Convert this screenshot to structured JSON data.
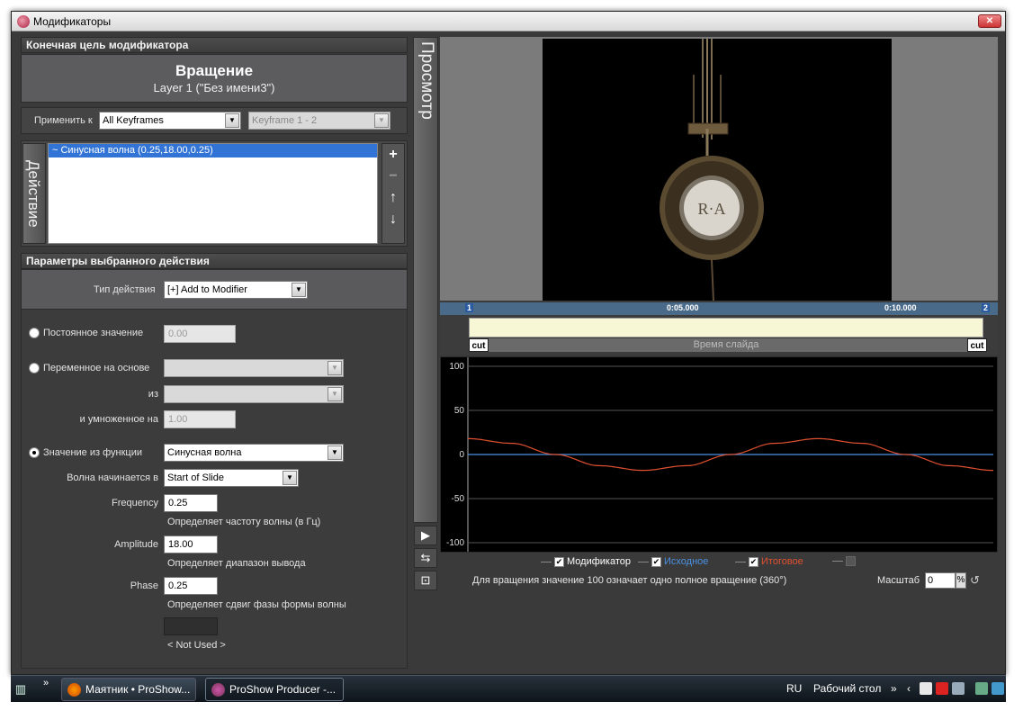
{
  "window": {
    "title": "Модификаторы",
    "close_label": "✕"
  },
  "target": {
    "header": "Конечная цель модификатора",
    "name": "Вращение",
    "layer": "Layer 1 (\"Без имени3\")"
  },
  "apply": {
    "label": "Применить к",
    "keyframes_value": "All Keyframes",
    "keyframe_range_value": "Keyframe 1 - 2"
  },
  "actions": {
    "tab_label": "Действие",
    "items": [
      "~ Синусная волна (0.25,18.00,0.25)"
    ],
    "buttons": {
      "add": "+",
      "remove": "−",
      "up": "↑",
      "down": "↓"
    }
  },
  "params": {
    "header": "Параметры выбранного действия",
    "type_label": "Тип действия",
    "type_value": "[+] Add to Modifier",
    "constant": {
      "label": "Постоянное значение",
      "value": "0.00",
      "selected": false
    },
    "variable": {
      "label": "Переменное на основе",
      "from_label": "из",
      "multiply_label": "и умноженное на",
      "multiply_value": "1.00",
      "selected": false
    },
    "function": {
      "label": "Значение из функции",
      "value": "Синусная волна",
      "selected": true,
      "wave_start_label": "Волна начинается в",
      "wave_start_value": "Start of Slide",
      "frequency_label": "Frequency",
      "frequency_value": "0.25",
      "frequency_hint": "Определяет частоту волны (в Гц)",
      "amplitude_label": "Amplitude",
      "amplitude_value": "18.00",
      "amplitude_hint": "Определяет диапазон вывода",
      "phase_label": "Phase",
      "phase_value": "0.25",
      "phase_hint": "Определяет сдвиг фазы формы волны",
      "not_used": "< Not Used >"
    }
  },
  "preview": {
    "tab_label": "Просмотр",
    "timeline": {
      "start_marker": "1",
      "end_marker": "2",
      "tick_1": "0:05.000",
      "tick_2": "0:10.000",
      "bar_label": "Время слайда",
      "cut_left": "cut",
      "cut_right": "cut"
    }
  },
  "chart_data": {
    "type": "line",
    "title": "",
    "xlabel": "",
    "ylabel": "",
    "ylim": [
      -100,
      100
    ],
    "yticks": [
      "100",
      "50",
      "0",
      "-50",
      "-100"
    ],
    "grid": true,
    "series": [
      {
        "name": "Модификатор",
        "color": "#ffffff",
        "visible": true,
        "values": []
      },
      {
        "name": "Исходное",
        "color": "#4a90e2",
        "visible": true,
        "values": [
          0,
          0,
          0,
          0,
          0,
          0,
          0,
          0,
          0,
          0,
          0,
          0,
          0
        ]
      },
      {
        "name": "Итоговое",
        "color": "#e05030",
        "visible": true,
        "values": [
          18,
          12.7,
          0,
          -12.7,
          -18,
          -12.7,
          0,
          12.7,
          18,
          12.7,
          0,
          -12.7,
          -18
        ]
      }
    ],
    "x": [
      0,
      1,
      2,
      3,
      4,
      5,
      6,
      7,
      8,
      9,
      10,
      11,
      12
    ]
  },
  "legend": {
    "modifier": "Модификатор",
    "original": "Исходное",
    "result": "Итоговое",
    "fourth": ""
  },
  "footer": {
    "note": "Для вращения значение 100 означает одно полное вращение (360°)",
    "scale_label": "Масштаб",
    "scale_value": "0",
    "scale_unit": "%"
  },
  "taskbar": {
    "items": [
      "Маятник • ProShow...",
      "ProShow Producer -..."
    ],
    "lang": "RU",
    "desktop": "Рабочий стол"
  },
  "colors": {
    "accent": "#3274d6",
    "panel": "#3a3a3a",
    "graph_bg": "#000000"
  }
}
